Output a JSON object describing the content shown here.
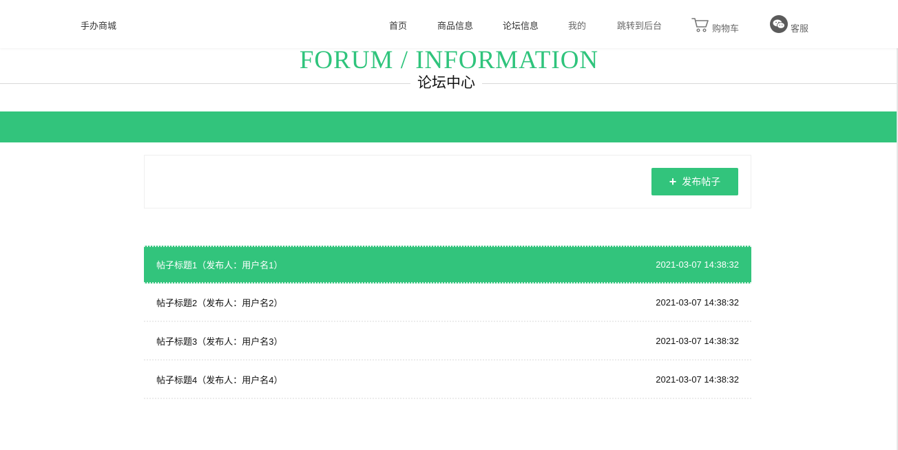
{
  "header": {
    "brand": "手办商城",
    "nav": [
      "首页",
      "商品信息",
      "论坛信息",
      "我的",
      "跳转到后台"
    ],
    "cart_label": "购物车",
    "service_label": "客服"
  },
  "section": {
    "title_en": "FORUM / INFORMATION",
    "title_zh": "论坛中心"
  },
  "toolbar": {
    "publish_label": "发布帖子"
  },
  "posts": [
    {
      "title": "帖子标题1（发布人：用户名1）",
      "time": "2021-03-07 14:38:32"
    },
    {
      "title": "帖子标题2（发布人：用户名2）",
      "time": "2021-03-07 14:38:32"
    },
    {
      "title": "帖子标题3（发布人：用户名3）",
      "time": "2021-03-07 14:38:32"
    },
    {
      "title": "帖子标题4（发布人：用户名4）",
      "time": "2021-03-07 14:38:32"
    }
  ],
  "colors": {
    "accent": "#32c47c",
    "title_green": "#2fc47c"
  },
  "icons": {
    "cart": "cart-icon",
    "service": "wechat-icon",
    "plus": "plus-icon"
  }
}
